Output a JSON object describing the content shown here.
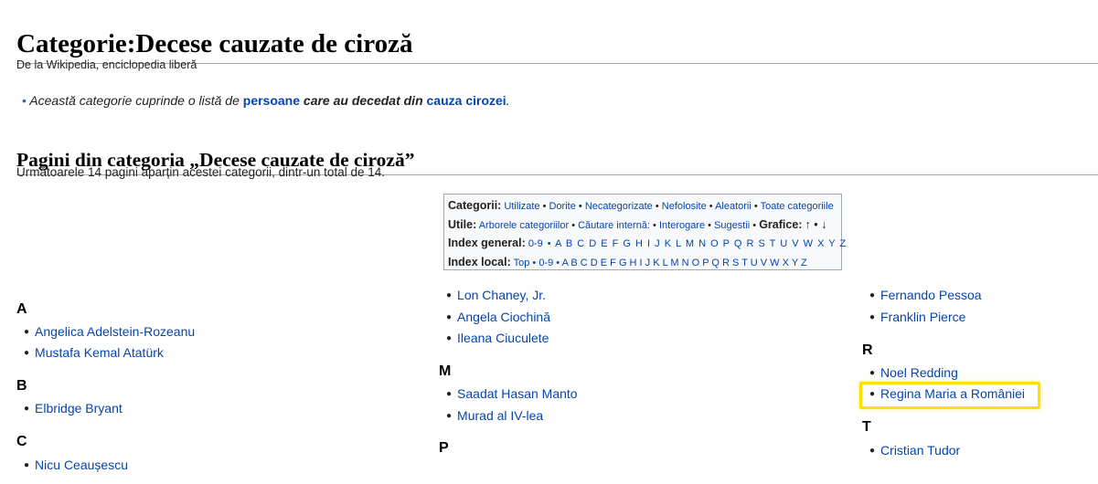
{
  "page": {
    "title": "Categorie:Decese cauzate de ciroză",
    "tagline": "De la Wikipedia, enciclopedia liberă"
  },
  "notice": {
    "prefix": "Această categorie cuprinde o listă de ",
    "link1": "persoane",
    "middle": " care au decedat din ",
    "link2": "cauza cirozei",
    "suffix": "."
  },
  "section": {
    "title": "Pagini din categoria „Decese cauzate de ciroză”",
    "count_text": "Următoarele 14 pagini aparțin acestei categorii, dintr-un total de 14."
  },
  "navbox": {
    "categorii_label": "Categorii:",
    "categorii_links": [
      "Utilizate",
      "Dorite",
      "Necategorizate",
      "Nefolosite",
      "Aleatorii",
      "Toate categoriile"
    ],
    "utile_label": "Utile:",
    "utile_links": [
      "Arborele categoriilor",
      "Căutare internă:",
      "Interogare",
      "Sugestii"
    ],
    "grafice_label": "Grafice:",
    "grafice_symbols": "↑ • ↓",
    "index_general_label": "Index general:",
    "index_general_links": "0-9 • A B C D E F G H I J K L M N O P Q R S T U V W X Y Z",
    "index_local_label": "Index local:",
    "index_local_links": "Top • 0-9 • A B C D E F G H I J K L M N O P Q R S T U V W X Y Z"
  },
  "columns": {
    "col1": {
      "h_a": "A",
      "a_items": [
        "Angelica Adelstein-Rozeanu",
        "Mustafa Kemal Atatürk"
      ],
      "h_b": "B",
      "b_items": [
        "Elbridge Bryant"
      ],
      "h_c": "C",
      "c_items": [
        "Nicu Ceaușescu"
      ]
    },
    "col2": {
      "top_items": [
        "Lon Chaney, Jr.",
        "Angela Ciochină",
        "Ileana Ciuculete"
      ],
      "h_m": "M",
      "m_items": [
        "Saadat Hasan Manto",
        "Murad al IV-lea"
      ],
      "h_p": "P"
    },
    "col3": {
      "top_items": [
        "Fernando Pessoa",
        "Franklin Pierce"
      ],
      "h_r": "R",
      "r_items": [
        "Noel Redding",
        "Regina Maria a României"
      ],
      "h_t": "T",
      "t_items": [
        "Cristian Tudor"
      ]
    }
  },
  "colors": {
    "link": "#0645ad",
    "highlight": "#ffe100",
    "border": "#a2a9b1"
  }
}
